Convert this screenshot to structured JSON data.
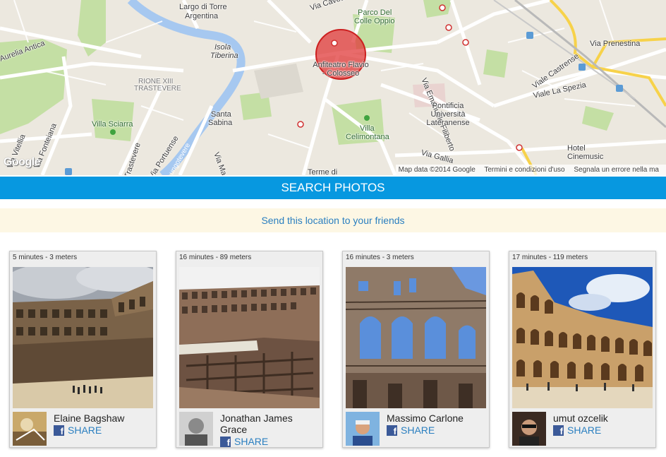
{
  "map": {
    "labels": {
      "largo": "Largo di Torre",
      "argentina": "Argentina",
      "via_cavour": "Via Cavour",
      "parco": "Parco Del",
      "colle_oppio": "Colle Oppio",
      "isola": "Isola",
      "tiberina": "Tiberina",
      "aurelia": "Aurelia Antica",
      "rione1": "RIONE XIII",
      "rione2": "TRASTEVERE",
      "anfiteatro": "Anfiteatro Flavio",
      "colosseo": "- Colosseo",
      "via_emanuele": "Via Emanuele Filiberto",
      "via_prenestina": "Via Prenestina",
      "via_castrense": "Viale Castrense",
      "viale_spezia": "Viale La Spezia",
      "pontificia": "Pontificia",
      "universita": "Università",
      "lateranense": "Lateranense",
      "santa": "Santa",
      "sabina": "Sabina",
      "villa_sciarra": "Villa Sciarra",
      "villa_celimontana1": "Villa",
      "villa_celimontana2": "Celimontana",
      "via_vitellia": "Via Vitellia",
      "fonteiana": "Via Fonteiana",
      "trastevere_road": "Trastevere",
      "via_portuense": "Via Portuense",
      "lungotevere": "Lungotevere",
      "via_ma": "Via Ma",
      "via_gallia": "Via Gallia",
      "terme": "Terme di",
      "hotel1": "Hotel",
      "hotel2": "Cinemusic"
    },
    "logo": "Google",
    "attribution": {
      "data": "Map data ©2014 Google",
      "terms": "Termini e condizioni d'uso",
      "report": "Segnala un errore nella ma"
    },
    "colors": {
      "base": "#ece8df",
      "road": "#ffffff",
      "river": "#a6c8f0",
      "park": "#c4dfa4",
      "highway": "#f7d24a",
      "marker": "#e03a3a"
    }
  },
  "search_bar": {
    "label": "SEARCH PHOTOS",
    "color": "#0798e0"
  },
  "send_bar": {
    "link": "Send this location to your friends"
  },
  "cards": [
    {
      "meta": "5 minutes - 3 meters",
      "user": "Elaine Bagshaw",
      "share": "SHARE"
    },
    {
      "meta": "16 minutes - 89 meters",
      "user": "Jonathan James Grace",
      "share": "SHARE"
    },
    {
      "meta": "16 minutes - 3 meters",
      "user": "Massimo Carlone",
      "share": "SHARE"
    },
    {
      "meta": "17 minutes - 119 meters",
      "user": "umut ozcelik",
      "share": "SHARE"
    }
  ]
}
